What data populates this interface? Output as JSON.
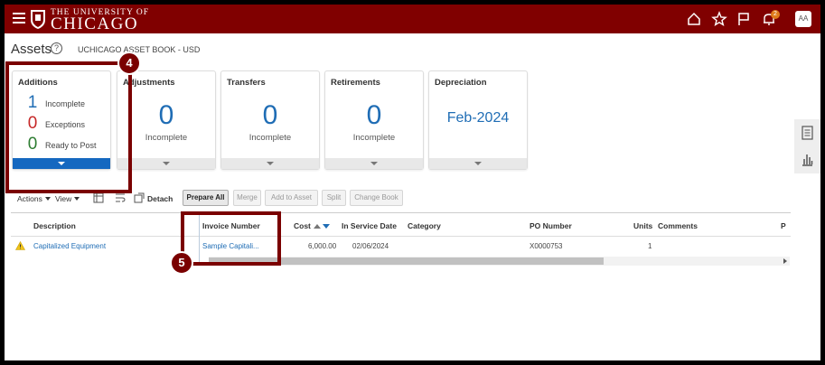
{
  "header": {
    "university_top": "THE UNIVERSITY OF",
    "university_main": "CHICAGO",
    "notification_count": "2",
    "avatar_initials": "AA",
    "brand_color": "#800000"
  },
  "page": {
    "title": "Assets",
    "book_label": "UCHICAGO ASSET BOOK - USD"
  },
  "cards": {
    "additions": {
      "title": "Additions",
      "rows": [
        {
          "count": "1",
          "label": "Incomplete",
          "color": "#1f6db5"
        },
        {
          "count": "0",
          "label": "Exceptions",
          "color": "#c62828"
        },
        {
          "count": "0",
          "label": "Ready to Post",
          "color": "#2e7d32"
        }
      ]
    },
    "adjustments": {
      "title": "Adjustments",
      "count": "0",
      "label": "Incomplete"
    },
    "transfers": {
      "title": "Transfers",
      "count": "0",
      "label": "Incomplete"
    },
    "retirements": {
      "title": "Retirements",
      "count": "0",
      "label": "Incomplete"
    },
    "depreciation": {
      "title": "Depreciation",
      "value": "Feb-2024"
    }
  },
  "toolbar": {
    "actions": "Actions",
    "view": "View",
    "detach": "Detach",
    "prepare_all": "Prepare All",
    "merge": "Merge",
    "add_to_asset": "Add to Asset",
    "split": "Split",
    "change_book": "Change Book"
  },
  "table": {
    "columns": {
      "description": "Description",
      "invoice_number": "Invoice Number",
      "cost": "Cost",
      "in_service_date": "In Service Date",
      "category": "Category",
      "po_number": "PO Number",
      "units": "Units",
      "comments": "Comments",
      "p": "P"
    },
    "rows": [
      {
        "description": "Capitalized Equipment",
        "invoice_number": "Sample Capitali...",
        "cost": "6,000.00",
        "in_service_date": "02/06/2024",
        "category": "",
        "po_number": "X0000753",
        "units": "1",
        "comments": ""
      }
    ]
  },
  "annotations": {
    "step4": "4",
    "step5": "5",
    "color": "#7a0000"
  }
}
